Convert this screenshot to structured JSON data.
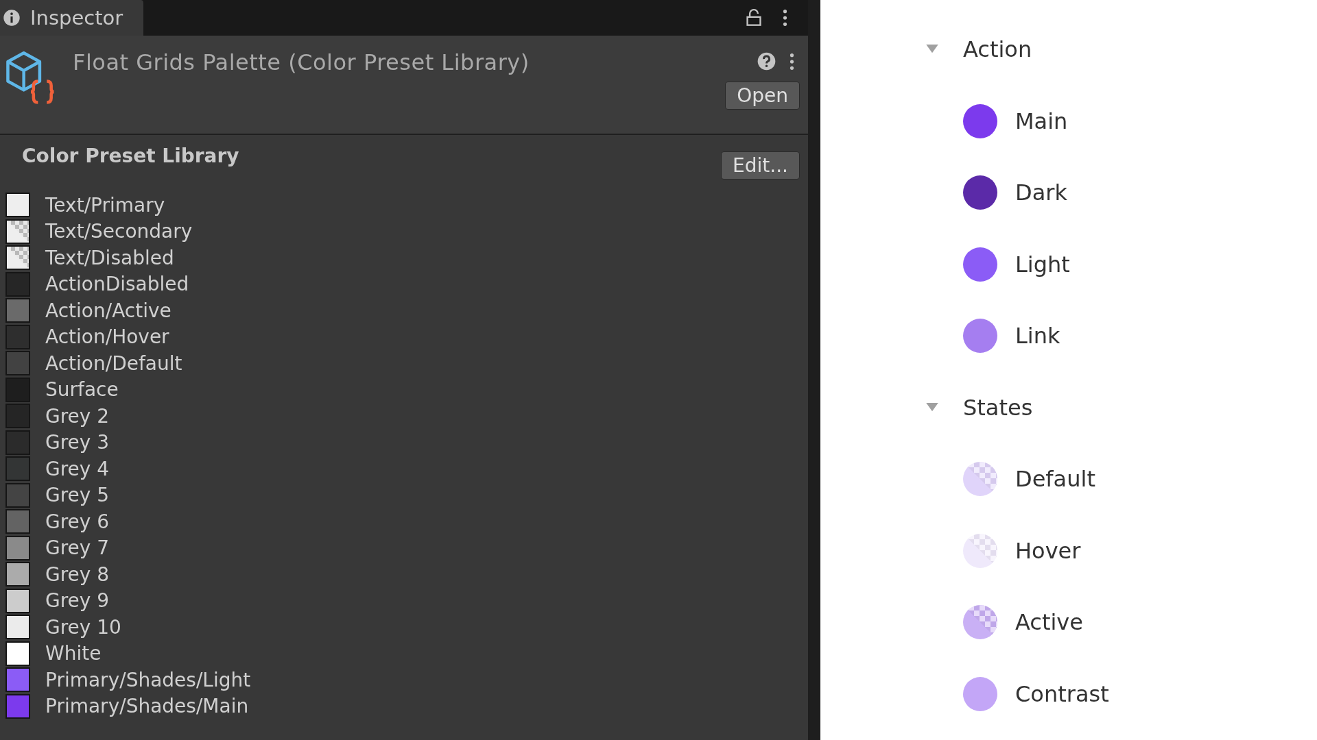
{
  "tab": {
    "label": "Inspector",
    "selected": true
  },
  "asset": {
    "title": "Float Grids Palette (Color Preset Library)",
    "open_button": "Open"
  },
  "library": {
    "heading": "Color Preset Library",
    "edit_button": "Edit...",
    "presets": [
      {
        "name": "Text/Primary",
        "color": "#eeeeee",
        "kind": "solid"
      },
      {
        "name": "Text/Secondary",
        "color": "#eeeeee",
        "kind": "translucent"
      },
      {
        "name": "Text/Disabled",
        "color": "#eeeeee",
        "kind": "translucent"
      },
      {
        "name": "ActionDisabled",
        "color": "#262626",
        "kind": "solid"
      },
      {
        "name": "Action/Active",
        "color": "#6a6a6a",
        "kind": "solid"
      },
      {
        "name": "Action/Hover",
        "color": "#2e2e2e",
        "kind": "solid"
      },
      {
        "name": "Action/Default",
        "color": "#424242",
        "kind": "solid"
      },
      {
        "name": "Surface",
        "color": "#1e1e1e",
        "kind": "solid"
      },
      {
        "name": "Grey 2",
        "color": "#252525",
        "kind": "solid"
      },
      {
        "name": "Grey 3",
        "color": "#2b2b2b",
        "kind": "solid"
      },
      {
        "name": "Grey 4",
        "color": "#333535",
        "kind": "solid"
      },
      {
        "name": "Grey 5",
        "color": "#444444",
        "kind": "solid"
      },
      {
        "name": "Grey 6",
        "color": "#636363",
        "kind": "solid"
      },
      {
        "name": "Grey 7",
        "color": "#8a8a8a",
        "kind": "solid"
      },
      {
        "name": "Grey 8",
        "color": "#ababab",
        "kind": "solid"
      },
      {
        "name": "Grey 9",
        "color": "#cccccc",
        "kind": "solid"
      },
      {
        "name": "Grey 10",
        "color": "#ebebeb",
        "kind": "solid"
      },
      {
        "name": "White",
        "color": "#ffffff",
        "kind": "solid"
      },
      {
        "name": "Primary/Shades/Light",
        "color": "#8b5cf6",
        "kind": "solid"
      },
      {
        "name": "Primary/Shades/Main",
        "color": "#7c3aed",
        "kind": "solid"
      }
    ]
  },
  "palette": [
    {
      "name": "Action",
      "expanded": true,
      "items": [
        {
          "name": "Main",
          "color": "#7c3aed",
          "kind": "solid"
        },
        {
          "name": "Dark",
          "color": "#5b2aa8",
          "kind": "solid"
        },
        {
          "name": "Light",
          "color": "#8b5cf6",
          "kind": "solid"
        },
        {
          "name": "Link",
          "color": "#a57ef0",
          "kind": "solid"
        }
      ]
    },
    {
      "name": "States",
      "expanded": true,
      "items": [
        {
          "name": "Default",
          "color": "#e0d4fa",
          "kind": "translucent"
        },
        {
          "name": "Hover",
          "color": "#efe9fb",
          "kind": "translucent"
        },
        {
          "name": "Active",
          "color": "#c9b0f5",
          "kind": "translucent"
        },
        {
          "name": "Contrast",
          "color": "#c3a6f7",
          "kind": "solid"
        }
      ]
    }
  ]
}
